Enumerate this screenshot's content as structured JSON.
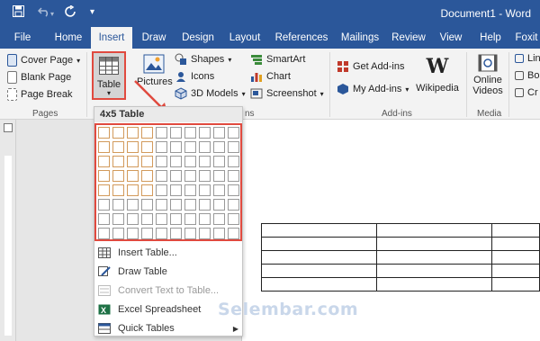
{
  "window": {
    "title": "Document1 - Word"
  },
  "quick_access": {
    "save": "save-icon",
    "undo": "undo-icon",
    "redo": "redo-icon",
    "customize": "▾"
  },
  "tabs": [
    {
      "label": "File"
    },
    {
      "label": "Home"
    },
    {
      "label": "Insert"
    },
    {
      "label": "Draw"
    },
    {
      "label": "Design"
    },
    {
      "label": "Layout"
    },
    {
      "label": "References"
    },
    {
      "label": "Mailings"
    },
    {
      "label": "Review"
    },
    {
      "label": "View"
    },
    {
      "label": "Help"
    },
    {
      "label": "Foxit"
    }
  ],
  "ribbon": {
    "pages": {
      "cover_page": "Cover Page",
      "blank_page": "Blank Page",
      "page_break": "Page Break",
      "group": "Pages"
    },
    "table": {
      "label": "Table"
    },
    "pictures": {
      "label": "Pictures"
    },
    "illustrations": {
      "shapes": "Shapes",
      "icons": "Icons",
      "models": "3D Models",
      "smartart": "SmartArt",
      "chart": "Chart",
      "screenshot": "Screenshot",
      "group_tail": "ns"
    },
    "addins": {
      "get": "Get Add-ins",
      "my": "My Add-ins",
      "wikipedia": "Wikipedia",
      "group": "Add-ins"
    },
    "media": {
      "online_videos_1": "Online",
      "online_videos_2": "Videos",
      "group": "Media"
    },
    "links": {
      "l1": "Lin",
      "l2": "Bo",
      "l3": "Cr"
    }
  },
  "dropdown": {
    "header": "4x5 Table",
    "grid": {
      "cols": 10,
      "rows": 8,
      "selected_cols": 4,
      "selected_rows": 5
    },
    "items": [
      {
        "label": "Insert Table...",
        "icon": "grid-icon",
        "disabled": false
      },
      {
        "label": "Draw Table",
        "icon": "pencil-icon",
        "disabled": false
      },
      {
        "label": "Convert Text to Table...",
        "icon": "convert-icon",
        "disabled": true
      },
      {
        "label": "Excel Spreadsheet",
        "icon": "excel-icon",
        "disabled": false
      },
      {
        "label": "Quick Tables",
        "icon": "quick-table-icon",
        "disabled": false,
        "submenu": "▶"
      }
    ]
  },
  "watermark": "Selembar.com",
  "colors": {
    "word_blue": "#2b579a",
    "highlight_red": "#e04a3f",
    "cell_selected": "#d29a5b"
  }
}
